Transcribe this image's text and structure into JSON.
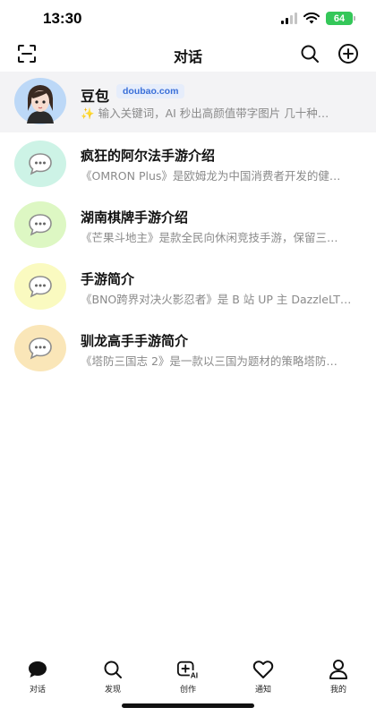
{
  "status": {
    "time": "13:30",
    "battery": "64"
  },
  "header": {
    "title": "对话"
  },
  "pinned": {
    "name": "豆包",
    "badge": "doubao.com",
    "sparkle": "✨",
    "hint": "输入关键词，AI 秒出高颜值带字图片 几十种…"
  },
  "chats": [
    {
      "title": "疯狂的阿尔法手游介绍",
      "preview": "《OMRON Plus》是欧姆龙为中国消费者开发的健…",
      "avatar_color": "#cdf3e6"
    },
    {
      "title": "湖南棋牌手游介绍",
      "preview": "《芒果斗地主》是款全民向休闲竞技手游，保留三…",
      "avatar_color": "#ddf7c3"
    },
    {
      "title": "手游简介",
      "preview": "《BNO跨界对决火影忍者》是 B 站 UP 主 DazzleLT…",
      "avatar_color": "#fafac0"
    },
    {
      "title": "驯龙高手手游简介",
      "preview": "《塔防三国志 2》是一款以三国为题材的策略塔防…",
      "avatar_color": "#fae6b8"
    }
  ],
  "tabs": [
    {
      "label": "对话",
      "icon": "chat-bubble-icon"
    },
    {
      "label": "发现",
      "icon": "search-icon"
    },
    {
      "label": "创作",
      "icon": "create-ai-icon",
      "icon_text": "AI"
    },
    {
      "label": "通知",
      "icon": "heart-icon"
    },
    {
      "label": "我的",
      "icon": "person-icon"
    }
  ],
  "colors": {
    "accent_badge": "#3a6fd8",
    "battery": "#34c759",
    "pinned_bg": "#f3f3f5"
  }
}
